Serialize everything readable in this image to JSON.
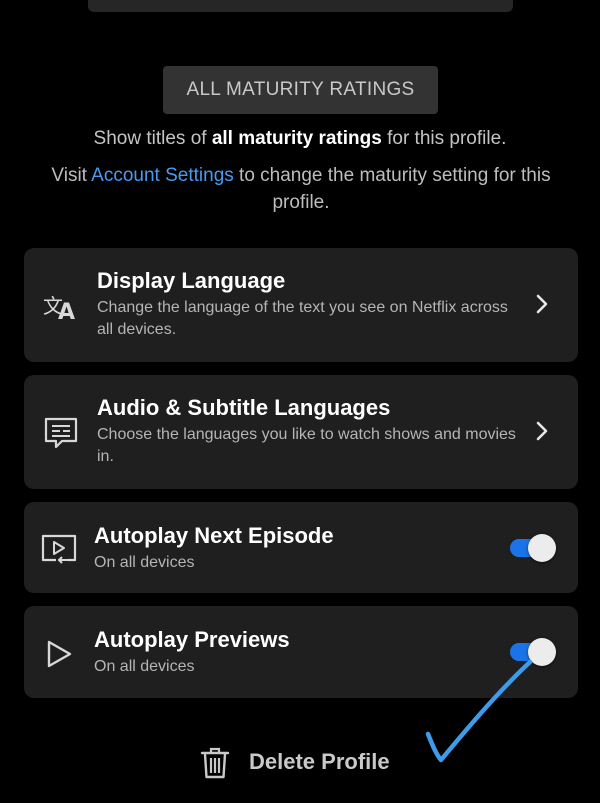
{
  "maturity": {
    "badge_label": "ALL MATURITY RATINGS",
    "line1_prefix": "Show titles of ",
    "line1_bold": "all maturity ratings",
    "line1_suffix": " for this profile.",
    "line2_prefix": "Visit ",
    "line2_link": "Account Settings",
    "line2_suffix": " to change the maturity setting for this profile."
  },
  "settings": {
    "display_language": {
      "title": "Display Language",
      "description": "Change the language of the text you see on Netflix across all devices.",
      "icon": "language-icon"
    },
    "audio_subtitle": {
      "title": "Audio & Subtitle Languages",
      "description": "Choose the languages you like to watch shows and movies in.",
      "icon": "subtitles-icon"
    },
    "autoplay_next": {
      "title": "Autoplay Next Episode",
      "description": "On all devices",
      "enabled": true,
      "icon": "autoplay-next-icon"
    },
    "autoplay_previews": {
      "title": "Autoplay Previews",
      "description": "On all devices",
      "enabled": true,
      "icon": "play-icon"
    }
  },
  "delete_profile": {
    "label": "Delete Profile",
    "icon": "trash-icon"
  },
  "colors": {
    "background": "#000000",
    "card": "#1f1f1f",
    "link": "#4a9af2",
    "toggle_on": "#1a73e8",
    "annotation_check": "#3d9be9"
  }
}
